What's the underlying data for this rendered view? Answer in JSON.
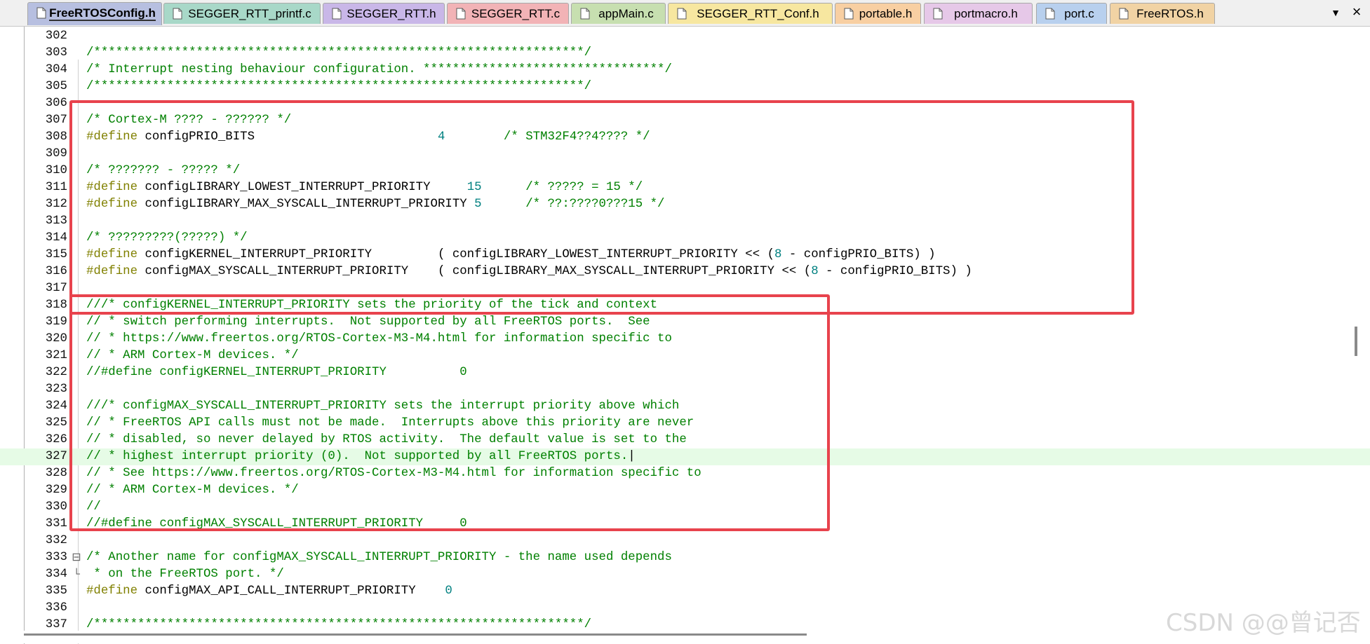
{
  "tabs": [
    {
      "label": "FreeRTOSConfig.h",
      "color": "#b7bfe0",
      "active": true
    },
    {
      "label": "SEGGER_RTT_printf.c",
      "color": "#a8d8c8"
    },
    {
      "label": "SEGGER_RTT.h",
      "color": "#c9b7e8"
    },
    {
      "label": "SEGGER_RTT.c",
      "color": "#f2b3b6"
    },
    {
      "label": "appMain.c",
      "color": "#c7dfb0"
    },
    {
      "label": "SEGGER_RTT_Conf.h",
      "color": "#f7e7a0"
    },
    {
      "label": "portable.h",
      "color": "#f8cfa2"
    },
    {
      "label": "portmacro.h",
      "color": "#e6c8e8"
    },
    {
      "label": "port.c",
      "color": "#b8d0ee"
    },
    {
      "label": "FreeRTOS.h",
      "color": "#f1d3a4"
    }
  ],
  "tab_menu_glyph": "▼",
  "tab_close_glyph": "×",
  "current_line": 327,
  "lines": [
    {
      "num": "302",
      "segs": []
    },
    {
      "num": "303",
      "segs": [
        {
          "t": "/*******************************************************************/",
          "c": "c"
        }
      ]
    },
    {
      "num": "304",
      "segs": [
        {
          "t": "/* Interrupt nesting behaviour configuration. *********************************/",
          "c": "c"
        }
      ]
    },
    {
      "num": "305",
      "segs": [
        {
          "t": "/*******************************************************************/",
          "c": "c"
        }
      ]
    },
    {
      "num": "306",
      "segs": []
    },
    {
      "num": "307",
      "segs": [
        {
          "t": "/* Cortex-M ???? - ?????? */",
          "c": "c"
        }
      ]
    },
    {
      "num": "308",
      "segs": [
        {
          "t": "#define",
          "c": "p"
        },
        {
          "t": " configPRIO_BITS                         ",
          "c": "d"
        },
        {
          "t": "4",
          "c": "n"
        },
        {
          "t": "        ",
          "c": "d"
        },
        {
          "t": "/* STM32F4??4???? */",
          "c": "c"
        }
      ]
    },
    {
      "num": "309",
      "segs": []
    },
    {
      "num": "310",
      "segs": [
        {
          "t": "/* ??????? - ????? */",
          "c": "c"
        }
      ]
    },
    {
      "num": "311",
      "segs": [
        {
          "t": "#define",
          "c": "p"
        },
        {
          "t": " configLIBRARY_LOWEST_INTERRUPT_PRIORITY     ",
          "c": "d"
        },
        {
          "t": "15",
          "c": "n"
        },
        {
          "t": "      ",
          "c": "d"
        },
        {
          "t": "/* ????? = 15 */",
          "c": "c"
        }
      ]
    },
    {
      "num": "312",
      "segs": [
        {
          "t": "#define",
          "c": "p"
        },
        {
          "t": " configLIBRARY_MAX_SYSCALL_INTERRUPT_PRIORITY ",
          "c": "d"
        },
        {
          "t": "5",
          "c": "n"
        },
        {
          "t": "      ",
          "c": "d"
        },
        {
          "t": "/* ??:????0???15 */",
          "c": "c"
        }
      ]
    },
    {
      "num": "313",
      "segs": []
    },
    {
      "num": "314",
      "segs": [
        {
          "t": "/* ?????????(?????) */",
          "c": "c"
        }
      ]
    },
    {
      "num": "315",
      "segs": [
        {
          "t": "#define",
          "c": "p"
        },
        {
          "t": " configKERNEL_INTERRUPT_PRIORITY         ( configLIBRARY_LOWEST_INTERRUPT_PRIORITY << (",
          "c": "d"
        },
        {
          "t": "8",
          "c": "n"
        },
        {
          "t": " - configPRIO_BITS) )",
          "c": "d"
        }
      ]
    },
    {
      "num": "316",
      "segs": [
        {
          "t": "#define",
          "c": "p"
        },
        {
          "t": " configMAX_SYSCALL_INTERRUPT_PRIORITY    ( configLIBRARY_MAX_SYSCALL_INTERRUPT_PRIORITY << (",
          "c": "d"
        },
        {
          "t": "8",
          "c": "n"
        },
        {
          "t": " - configPRIO_BITS) )",
          "c": "d"
        }
      ]
    },
    {
      "num": "317",
      "segs": []
    },
    {
      "num": "318",
      "segs": [
        {
          "t": "///* configKERNEL_INTERRUPT_PRIORITY sets the priority of the tick and context",
          "c": "c"
        }
      ]
    },
    {
      "num": "319",
      "segs": [
        {
          "t": "// * switch performing interrupts.  Not supported by all FreeRTOS ports.  See",
          "c": "c"
        }
      ]
    },
    {
      "num": "320",
      "segs": [
        {
          "t": "// * https://www.freertos.org/RTOS-Cortex-M3-M4.html for information specific to",
          "c": "c"
        }
      ]
    },
    {
      "num": "321",
      "segs": [
        {
          "t": "// * ARM Cortex-M devices. */",
          "c": "c"
        }
      ]
    },
    {
      "num": "322",
      "segs": [
        {
          "t": "//#define configKERNEL_INTERRUPT_PRIORITY          0",
          "c": "c"
        }
      ]
    },
    {
      "num": "323",
      "segs": []
    },
    {
      "num": "324",
      "segs": [
        {
          "t": "///* configMAX_SYSCALL_INTERRUPT_PRIORITY sets the interrupt priority above which",
          "c": "c"
        }
      ]
    },
    {
      "num": "325",
      "segs": [
        {
          "t": "// * FreeRTOS API calls must not be made.  Interrupts above this priority are never",
          "c": "c"
        }
      ]
    },
    {
      "num": "326",
      "segs": [
        {
          "t": "// * disabled, so never delayed by RTOS activity.  The default value is set to the",
          "c": "c"
        }
      ]
    },
    {
      "num": "327",
      "segs": [
        {
          "t": "// * highest interrupt priority (0).  Not supported by all FreeRTOS ports.",
          "c": "c"
        },
        {
          "t": "|",
          "c": "d"
        }
      ]
    },
    {
      "num": "328",
      "segs": [
        {
          "t": "// * See https://www.freertos.org/RTOS-Cortex-M3-M4.html for information specific to",
          "c": "c"
        }
      ]
    },
    {
      "num": "329",
      "segs": [
        {
          "t": "// * ARM Cortex-M devices. */",
          "c": "c"
        }
      ]
    },
    {
      "num": "330",
      "segs": [
        {
          "t": "//",
          "c": "c"
        }
      ]
    },
    {
      "num": "331",
      "segs": [
        {
          "t": "//#define configMAX_SYSCALL_INTERRUPT_PRIORITY     0",
          "c": "c"
        }
      ]
    },
    {
      "num": "332",
      "segs": []
    },
    {
      "num": "333",
      "fold": "⊟",
      "segs": [
        {
          "t": "/* Another name for configMAX_SYSCALL_INTERRUPT_PRIORITY - the name used depends",
          "c": "c"
        }
      ]
    },
    {
      "num": "334",
      "fold": "└",
      "segs": [
        {
          "t": " * on the FreeRTOS port. */",
          "c": "c"
        }
      ]
    },
    {
      "num": "335",
      "segs": [
        {
          "t": "#define",
          "c": "p"
        },
        {
          "t": " configMAX_API_CALL_INTERRUPT_PRIORITY    ",
          "c": "d"
        },
        {
          "t": "0",
          "c": "n"
        }
      ]
    },
    {
      "num": "336",
      "segs": []
    },
    {
      "num": "337",
      "segs": [
        {
          "t": "/*******************************************************************/",
          "c": "c"
        }
      ]
    }
  ],
  "watermark": "CSDN @@曾记否",
  "highlight_color": "#e8434d"
}
